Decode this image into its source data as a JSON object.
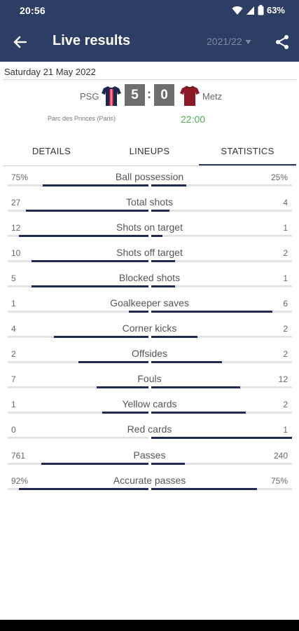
{
  "status_bar": {
    "time": "20:56",
    "battery": "63%",
    "icons": [
      "wifi-icon",
      "signal-icon",
      "battery-icon"
    ]
  },
  "app_bar": {
    "title": "Live results",
    "season": "2021/22",
    "back_icon": "arrow-left-icon",
    "season_icon": "caret-down-icon",
    "share_icon": "share-icon"
  },
  "match": {
    "date": "Saturday 21 May 2022",
    "home_team": "PSG",
    "away_team": "Metz",
    "home_score": "5",
    "score_separator": ":",
    "away_score": "0",
    "venue": "Parc des Princes (Paris)",
    "kickoff": "22:00"
  },
  "tabs": [
    {
      "label": "DETAILS",
      "active": false
    },
    {
      "label": "LINEUPS",
      "active": false
    },
    {
      "label": "STATISTICS",
      "active": true
    }
  ],
  "statistics": [
    {
      "label": "Ball possession",
      "home": "75%",
      "away": "25%",
      "home_fraction": 0.75,
      "away_fraction": 0.25
    },
    {
      "label": "Total shots",
      "home": "27",
      "away": "4",
      "home_fraction": 0.87,
      "away_fraction": 0.13
    },
    {
      "label": "Shots on target",
      "home": "12",
      "away": "1",
      "home_fraction": 0.92,
      "away_fraction": 0.08
    },
    {
      "label": "Shots off target",
      "home": "10",
      "away": "2",
      "home_fraction": 0.83,
      "away_fraction": 0.17
    },
    {
      "label": "Blocked shots",
      "home": "5",
      "away": "1",
      "home_fraction": 0.83,
      "away_fraction": 0.17
    },
    {
      "label": "Goalkeeper saves",
      "home": "1",
      "away": "6",
      "home_fraction": 0.14,
      "away_fraction": 0.86
    },
    {
      "label": "Corner kicks",
      "home": "4",
      "away": "2",
      "home_fraction": 0.67,
      "away_fraction": 0.33
    },
    {
      "label": "Offsides",
      "home": "2",
      "away": "2",
      "home_fraction": 0.5,
      "away_fraction": 0.5
    },
    {
      "label": "Fouls",
      "home": "7",
      "away": "12",
      "home_fraction": 0.37,
      "away_fraction": 0.63
    },
    {
      "label": "Yellow cards",
      "home": "1",
      "away": "2",
      "home_fraction": 0.33,
      "away_fraction": 0.67
    },
    {
      "label": "Red cards",
      "home": "0",
      "away": "1",
      "home_fraction": 0.0,
      "away_fraction": 1.0
    },
    {
      "label": "Passes",
      "home": "761",
      "away": "240",
      "home_fraction": 0.76,
      "away_fraction": 0.24
    },
    {
      "label": "Accurate passes",
      "home": "92%",
      "away": "75%",
      "home_fraction": 0.92,
      "away_fraction": 0.75
    }
  ],
  "colors": {
    "header": "#2c3e63",
    "bar_fill": "#1f2a55",
    "bar_track": "#e2e2e2",
    "score_box": "#6e6e6e",
    "kickoff": "#4caf50",
    "home_jersey": "#1a2850",
    "away_jersey": "#8b1a25"
  }
}
